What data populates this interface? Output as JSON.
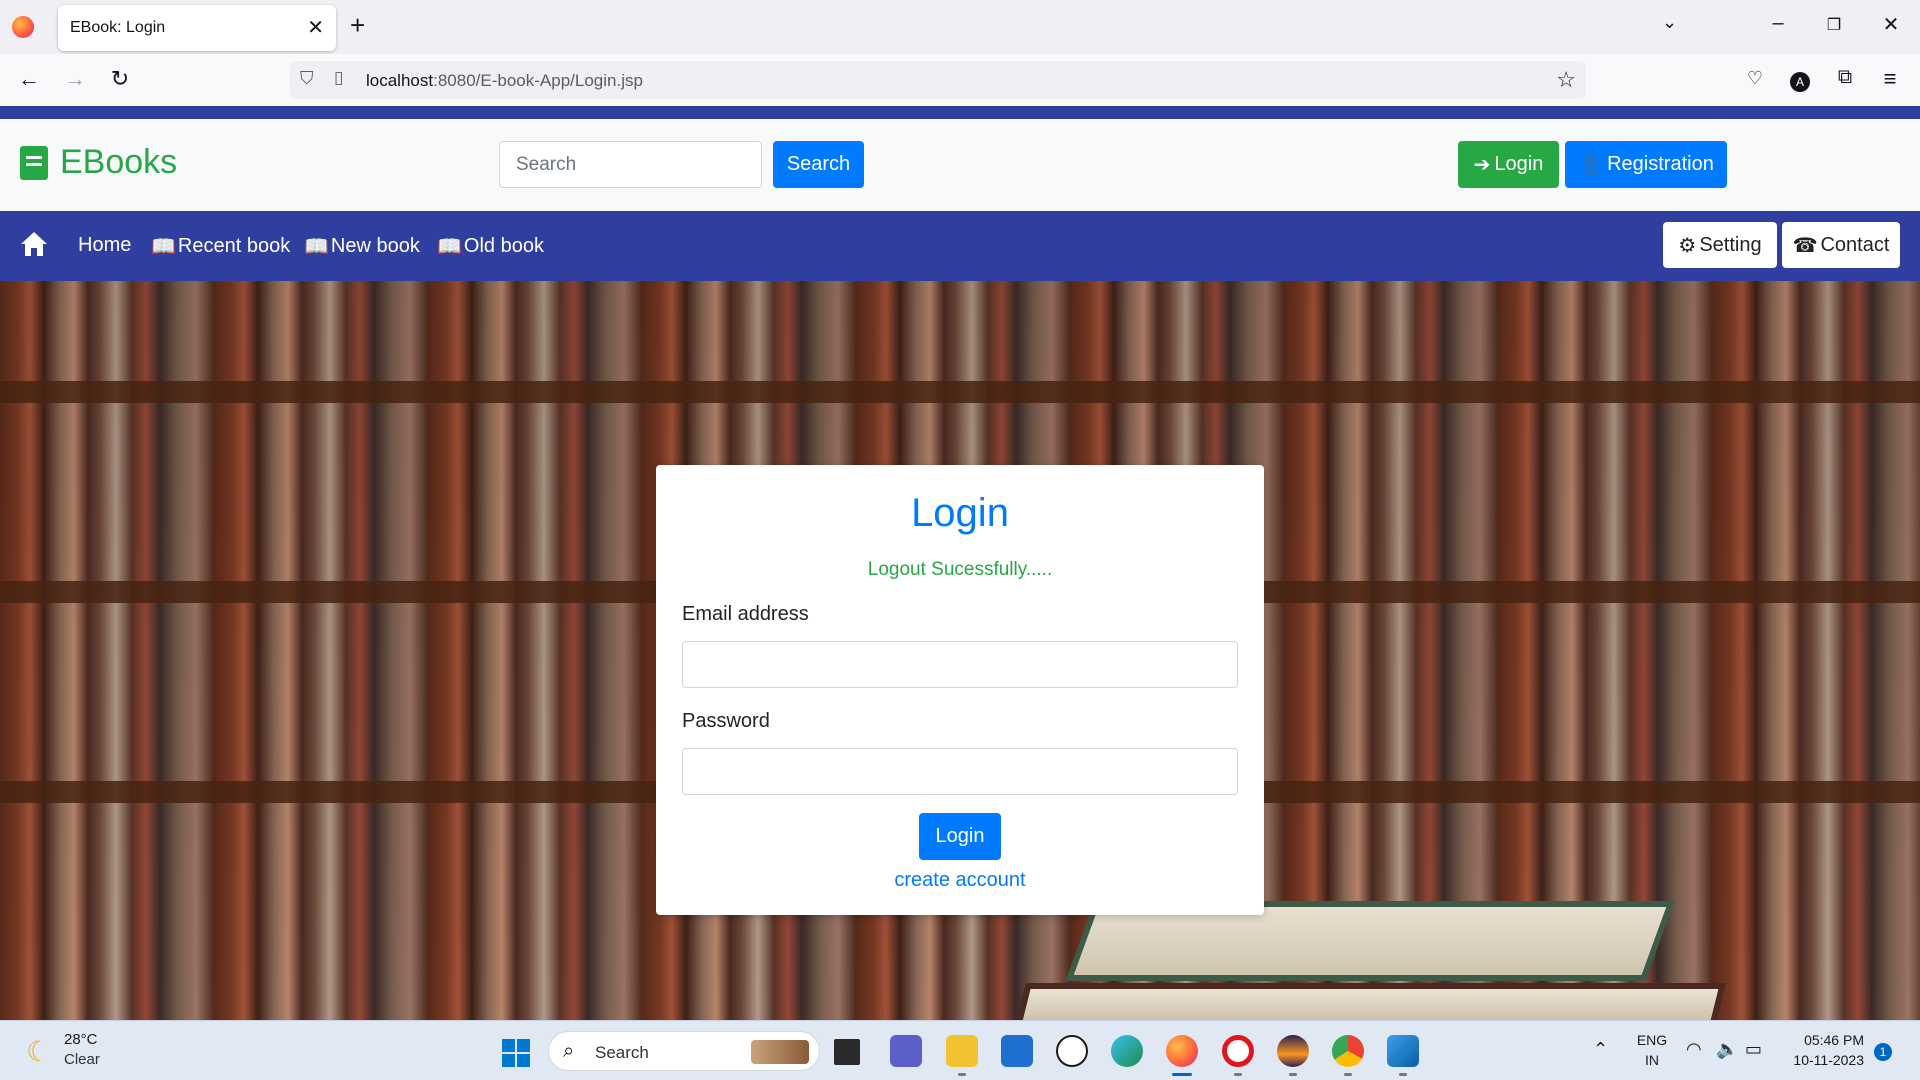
{
  "browser": {
    "tab_title": "EBook: Login",
    "url_host": "localhost",
    "url_rest": ":8080/E-book-App/Login.jsp"
  },
  "site": {
    "brand": "EBooks",
    "search_placeholder": "Search",
    "search_button": "Search",
    "login_button": "Login",
    "registration_button": "Registration",
    "menu": {
      "home": "Home",
      "recent": "Recent book",
      "new": "New book",
      "old": "Old book",
      "setting": "Setting",
      "contact": "Contact"
    }
  },
  "login_card": {
    "title": "Login",
    "message": "Logout Sucessfully.....",
    "email_label": "Email address",
    "email_value": "",
    "password_label": "Password",
    "password_value": "",
    "submit": "Login",
    "create_link": "create account"
  },
  "taskbar": {
    "temperature": "28°C",
    "weather": "Clear",
    "search": "Search",
    "lang_top": "ENG",
    "lang_bottom": "IN",
    "time": "05:46 PM",
    "date": "10-11-2023",
    "notifications": "1"
  },
  "colors": {
    "brand_green": "#28a745",
    "primary_blue": "#007bff",
    "nav_indigo": "#303f9f"
  }
}
